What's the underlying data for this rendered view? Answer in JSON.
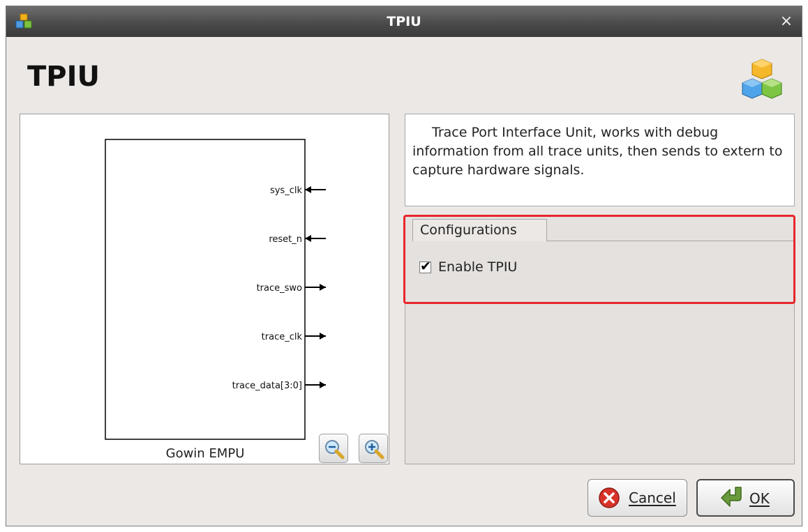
{
  "window": {
    "title": "TPIU",
    "close_glyph": "×"
  },
  "header": {
    "title": "TPIU"
  },
  "diagram": {
    "block_label": "Gowin EMPU",
    "ports": [
      {
        "name": "sys_clk",
        "direction": "in"
      },
      {
        "name": "reset_n",
        "direction": "in"
      },
      {
        "name": "trace_swo",
        "direction": "out"
      },
      {
        "name": "trace_clk",
        "direction": "out"
      },
      {
        "name": "trace_data[3:0]",
        "direction": "out"
      }
    ],
    "zoom_out_icon": "zoom-out-icon",
    "zoom_in_icon": "zoom-in-icon"
  },
  "description": "Trace Port Interface Unit, works with debug information from all trace units, then sends to extern to capture hardware signals.",
  "config": {
    "tab_label": "Configurations",
    "enable_label": "Enable TPIU",
    "enable_checked": true,
    "check_glyph": "✔"
  },
  "buttons": {
    "cancel": "Cancel",
    "ok": "OK"
  },
  "colors": {
    "highlight": "#e8262c",
    "titlebar": "#4b4b4b"
  }
}
